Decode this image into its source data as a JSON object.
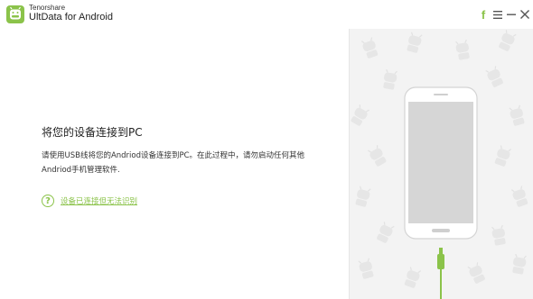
{
  "app": {
    "company": "Tenorshare",
    "name": "UltData for Android"
  },
  "window_controls": {
    "facebook_glyph": "f",
    "menu_icon": "hamburger-menu-icon",
    "minimize_icon": "minimize-icon",
    "close_icon": "close-icon"
  },
  "content": {
    "heading": "将您的设备连接到PC",
    "description_line1": "请使用USB线将您的Andriod设备连接到PC。在此过程中，请勿启动任何其他",
    "description_line2": "Andriod手机管理软件.",
    "help_glyph": "?",
    "help_link": "设备已连接但无法识别"
  },
  "colors": {
    "accent": "#8bc34a",
    "pane_bg": "#f3f3f3",
    "phone_body": "#ffffff",
    "phone_screen": "#d6d6d6"
  }
}
